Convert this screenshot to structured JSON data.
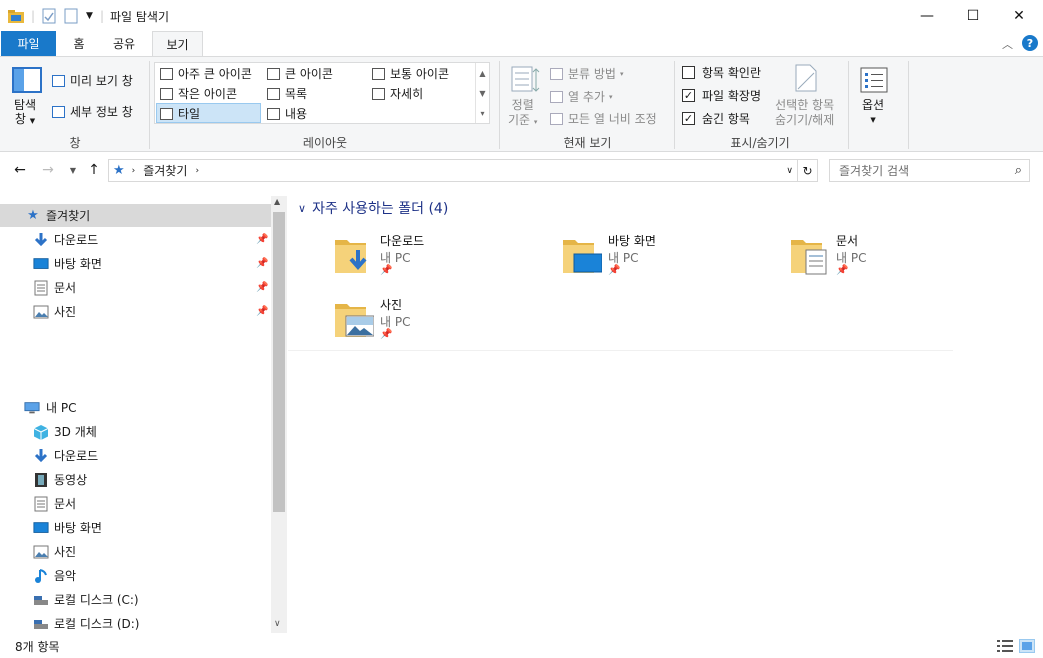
{
  "window": {
    "title": "파일 탐색기",
    "minimize_glyph": "—",
    "maximize_glyph": "☐",
    "close_glyph": "✕"
  },
  "tabs": {
    "file": "파일",
    "home": "홈",
    "share": "공유",
    "view": "보기"
  },
  "ribbon": {
    "pane_group": {
      "label": "창",
      "navigation_pane": "탐색\n창",
      "nav_pane_line1": "탐색",
      "nav_pane_line2": "창",
      "preview": "미리 보기 창",
      "details": "세부 정보 창"
    },
    "layout_group": {
      "label": "레이아웃",
      "items": [
        "아주 큰 아이콘",
        "큰 아이콘",
        "보통 아이콘",
        "작은 아이콘",
        "목록",
        "자세히",
        "타일",
        "내용"
      ],
      "selected": "타일"
    },
    "current_view_group": {
      "label": "현재 보기",
      "sort_by_line1": "정렬",
      "sort_by_line2": "기준",
      "group_by": "분류 방법",
      "add_columns": "열 추가",
      "size_all_columns": "모든 열 너비 조정"
    },
    "show_hide_group": {
      "label": "표시/숨기기",
      "item_check_boxes": "항목 확인란",
      "item_check_boxes_checked": false,
      "file_extensions": "파일 확장명",
      "file_extensions_checked": true,
      "hidden_items": "숨긴 항목",
      "hidden_items_checked": true,
      "hide_selected_line1": "선택한 항목",
      "hide_selected_line2": "숨기기/해제"
    },
    "options": {
      "label": "옵션"
    }
  },
  "address": {
    "path": "즐겨찾기",
    "search_placeholder": "즐겨찾기 검색"
  },
  "nav": {
    "quick_access": "즐겨찾기",
    "pinned": [
      {
        "label": "다운로드",
        "icon": "download-icon"
      },
      {
        "label": "바탕 화면",
        "icon": "desktop-icon"
      },
      {
        "label": "문서",
        "icon": "documents-icon"
      },
      {
        "label": "사진",
        "icon": "pictures-icon"
      }
    ],
    "this_pc": "내 PC",
    "pc_items": [
      {
        "label": "3D 개체",
        "icon": "3d-objects-icon"
      },
      {
        "label": "다운로드",
        "icon": "download-icon"
      },
      {
        "label": "동영상",
        "icon": "videos-icon"
      },
      {
        "label": "문서",
        "icon": "documents-icon"
      },
      {
        "label": "바탕 화면",
        "icon": "desktop-icon"
      },
      {
        "label": "사진",
        "icon": "pictures-icon"
      },
      {
        "label": "음악",
        "icon": "music-icon"
      },
      {
        "label": "로컬 디스크 (C:)",
        "icon": "drive-icon"
      },
      {
        "label": "로컬 디스크 (D:)",
        "icon": "drive-icon"
      }
    ]
  },
  "content": {
    "group_title": "자주 사용하는 폴더 (4)",
    "tiles": [
      {
        "name": "다운로드",
        "location": "내 PC",
        "overlay": "download"
      },
      {
        "name": "바탕 화면",
        "location": "내 PC",
        "overlay": "desktop"
      },
      {
        "name": "문서",
        "location": "내 PC",
        "overlay": "document"
      },
      {
        "name": "사진",
        "location": "내 PC",
        "overlay": "picture"
      }
    ]
  },
  "status": {
    "item_count": "8개 항목"
  },
  "colors": {
    "accent": "#1979ca",
    "folder": "#f0c55a",
    "selection": "#cce4f7"
  }
}
